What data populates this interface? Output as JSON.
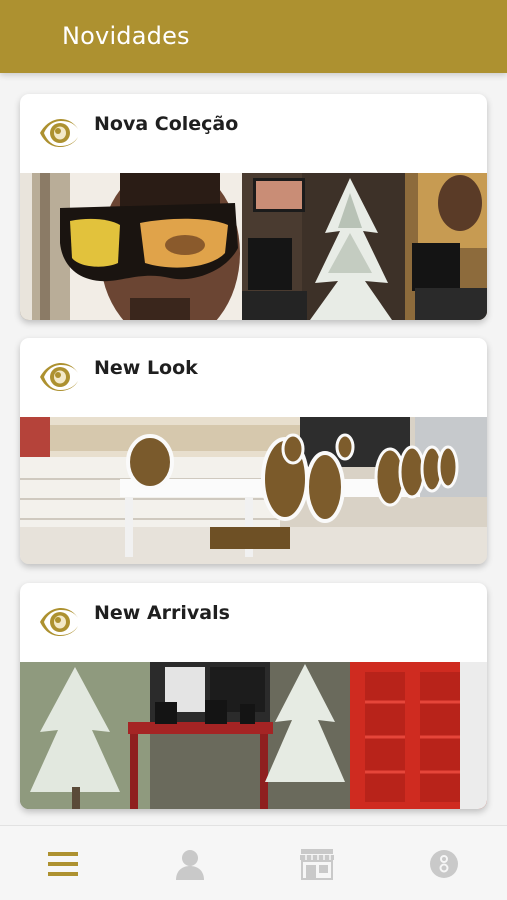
{
  "header": {
    "title": "Novidades",
    "background_color": "#ad9130"
  },
  "cards": [
    {
      "title": "Nova Coleção",
      "icon": "eye-icon",
      "image": "store-collection-photo"
    },
    {
      "title": "New Look",
      "icon": "eye-icon",
      "image": "store-interior-photo"
    },
    {
      "title": "New Arrivals",
      "icon": "eye-icon",
      "image": "store-arrivals-photo"
    }
  ],
  "bottom_nav": {
    "items": [
      {
        "icon": "menu-icon",
        "active": true
      },
      {
        "icon": "user-icon",
        "active": false
      },
      {
        "icon": "store-icon",
        "active": false
      },
      {
        "icon": "info-icon",
        "active": false
      }
    ],
    "active_color": "#ad9130",
    "inactive_color": "#c9c9c9"
  },
  "colors": {
    "accent": "#ad9130",
    "card_background": "#ffffff",
    "page_background": "#f4f4f4",
    "title_text": "#1f1f1f"
  }
}
